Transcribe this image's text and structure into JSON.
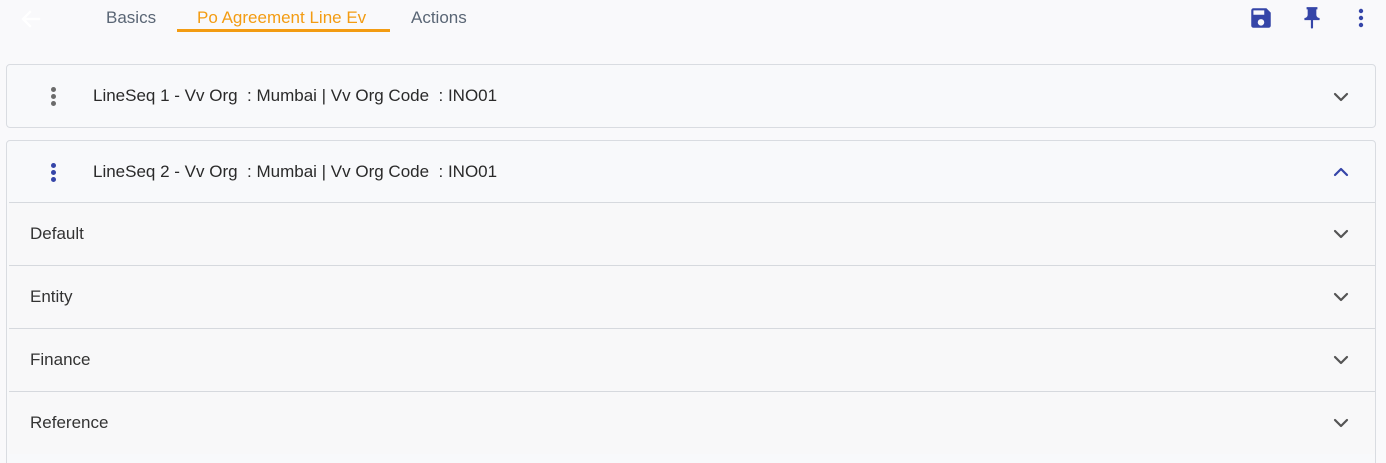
{
  "tabs": [
    {
      "label": "Basics"
    },
    {
      "label": "Po Agreement Line Ev"
    },
    {
      "label": "Actions"
    }
  ],
  "active_tab": "Po Agreement Line Ev",
  "icons": {
    "back": "arrow-left-icon",
    "save": "save-icon",
    "pin": "pin-icon",
    "more": "more-vertical-icon",
    "expand": "chevron-down-icon",
    "collapse": "chevron-up-icon"
  },
  "colors": {
    "accent_orange": "#f39c12",
    "primary_blue": "#3545a8",
    "tab_text": "#5a6675"
  },
  "lines": [
    {
      "title": "LineSeq 1 - Vv Org  : Mumbai | Vv Org Code  : INO01",
      "expanded": false
    },
    {
      "title": "LineSeq 2 - Vv Org  : Mumbai | Vv Org Code  : INO01",
      "expanded": true
    }
  ],
  "sections": [
    {
      "label": "Default"
    },
    {
      "label": "Entity"
    },
    {
      "label": "Finance"
    },
    {
      "label": "Reference"
    }
  ]
}
